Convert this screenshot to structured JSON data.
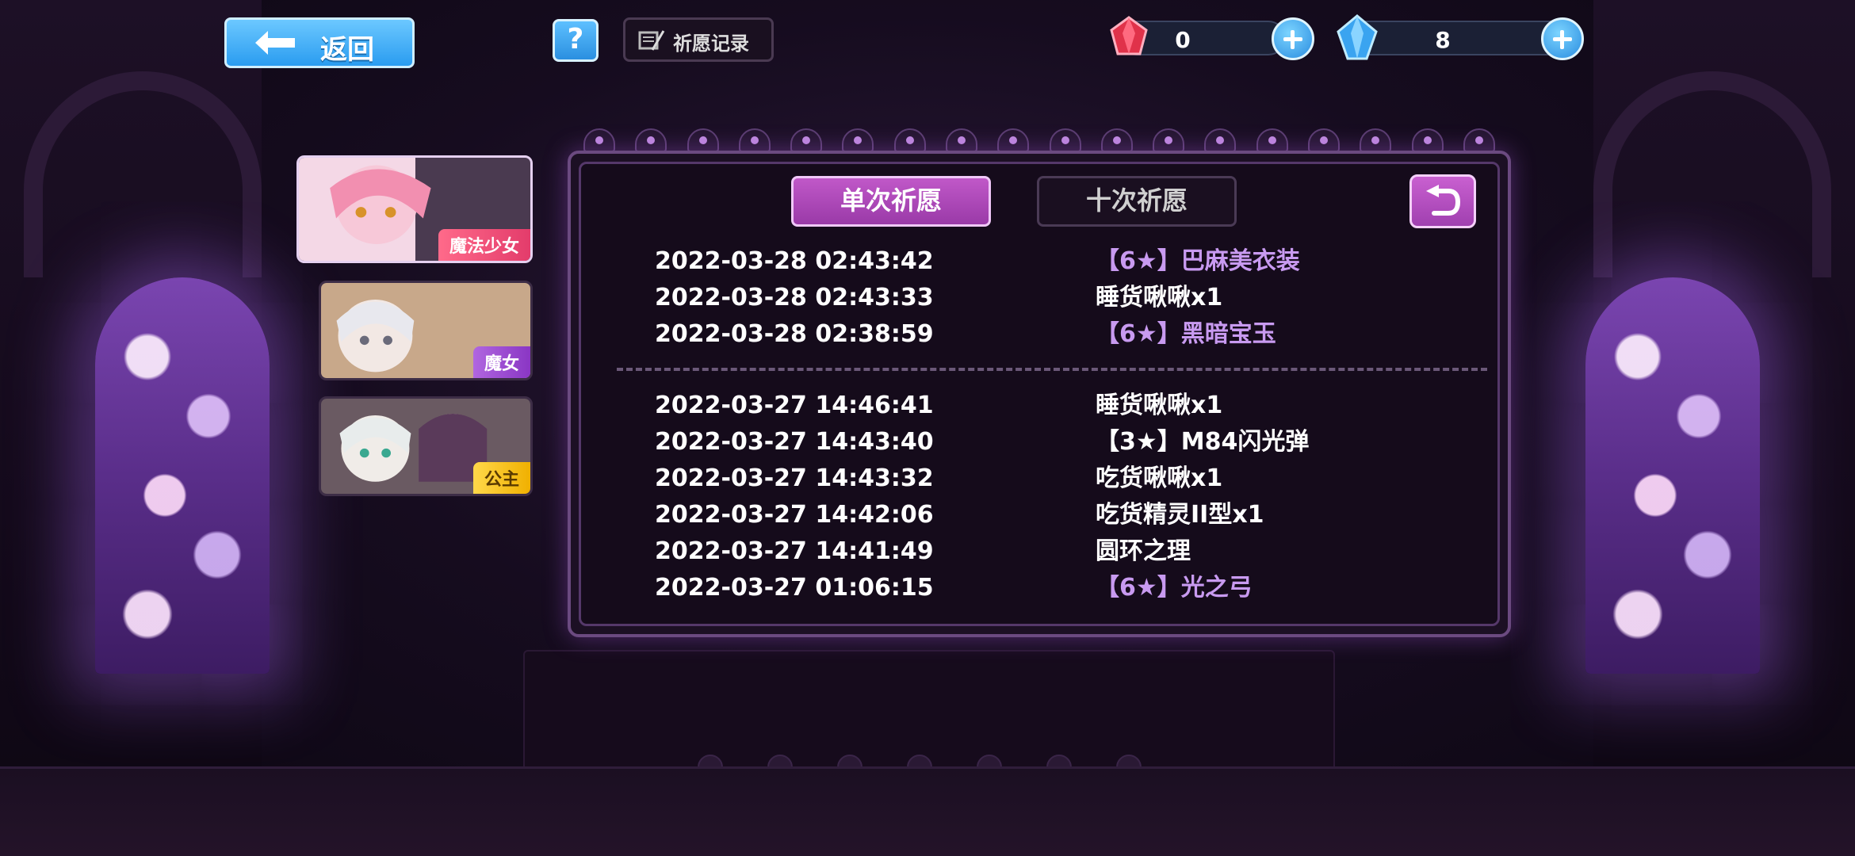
{
  "topbar": {
    "back_label": "返回",
    "help_label": "?",
    "record_label": "祈愿记录",
    "currency_red": {
      "value": "0",
      "icon": "red-gem-icon"
    },
    "currency_blue": {
      "value": "8",
      "icon": "blue-gem-icon"
    }
  },
  "characters": [
    {
      "label": "魔法少女"
    },
    {
      "label": "魔女"
    },
    {
      "label": "公主"
    }
  ],
  "tabs": {
    "single": "单次祈愿",
    "ten": "十次祈愿"
  },
  "records_group1": [
    {
      "time": "2022-03-28 02:43:42",
      "item": "【6★】巴麻美衣装",
      "rare": true
    },
    {
      "time": "2022-03-28 02:43:33",
      "item": "睡货啾啾x1",
      "rare": false
    },
    {
      "time": "2022-03-28 02:38:59",
      "item": "【6★】黑暗宝玉",
      "rare": true
    }
  ],
  "records_group2": [
    {
      "time": "2022-03-27 14:46:41",
      "item": "睡货啾啾x1",
      "rare": false
    },
    {
      "time": "2022-03-27 14:43:40",
      "item": "【3★】M84闪光弹",
      "rare": false
    },
    {
      "time": "2022-03-27 14:43:32",
      "item": "吃货啾啾x1",
      "rare": false
    },
    {
      "time": "2022-03-27 14:42:06",
      "item": "吃货精灵II型x1",
      "rare": false
    },
    {
      "time": "2022-03-27 14:41:49",
      "item": "圆环之理",
      "rare": false
    },
    {
      "time": "2022-03-27 01:06:15",
      "item": "【6★】光之弓",
      "rare": true
    }
  ],
  "colors": {
    "rare_text": "#c89af0",
    "active_tab": "#b04cbc",
    "blue_button": "#2a9cf0"
  }
}
